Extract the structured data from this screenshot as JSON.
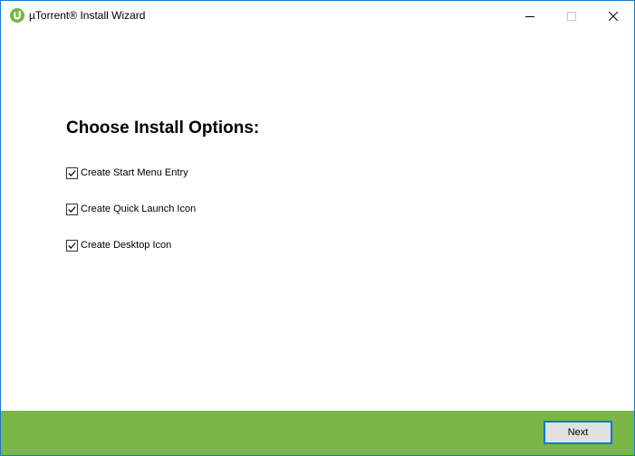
{
  "window": {
    "title": "µTorrent® Install Wizard",
    "app_icon": "utorrent-logo-icon",
    "controls": {
      "minimize_icon": "minimize-icon",
      "maximize_icon": "maximize-icon",
      "close_icon": "close-icon"
    },
    "border_color": "#1979ca"
  },
  "main": {
    "heading": "Choose Install Options:",
    "options": [
      {
        "label": "Create Start Menu Entry",
        "checked": true
      },
      {
        "label": "Create Quick Launch Icon",
        "checked": true
      },
      {
        "label": "Create Desktop Icon",
        "checked": true
      }
    ]
  },
  "footer": {
    "background_color": "#7ab648",
    "next_label": "Next"
  }
}
